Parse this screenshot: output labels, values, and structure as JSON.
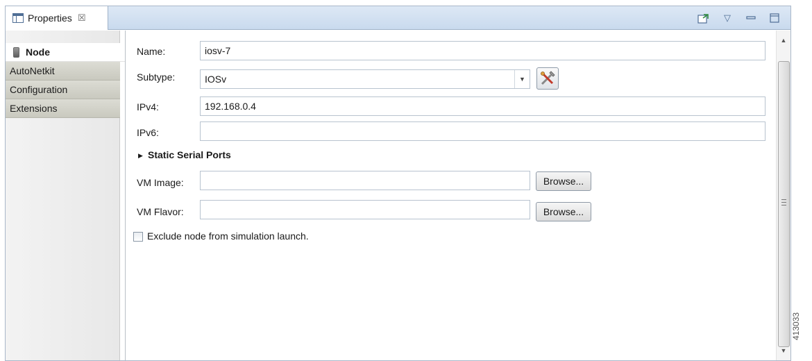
{
  "window": {
    "tab_title": "Properties",
    "tab_close_glyph": "☒",
    "actions": [
      {
        "name": "pin-editor-icon",
        "glyph": "↱"
      },
      {
        "name": "view-menu-icon",
        "glyph": "▽"
      },
      {
        "name": "minimize-icon",
        "glyph": "━"
      },
      {
        "name": "maximize-icon",
        "glyph": "□"
      }
    ]
  },
  "sidebar": {
    "items": [
      {
        "label": "Node",
        "selected": true,
        "icon": "node-icon"
      },
      {
        "label": "AutoNetkit",
        "selected": false
      },
      {
        "label": "Configuration",
        "selected": false
      },
      {
        "label": "Extensions",
        "selected": false
      }
    ]
  },
  "form": {
    "name": {
      "label": "Name:",
      "value": "iosv-7"
    },
    "subtype": {
      "label": "Subtype:",
      "value": "IOSv",
      "dropdown_glyph": "▼",
      "tool_icon": "configure-tools-icon"
    },
    "ipv4": {
      "label": "IPv4:",
      "value": "192.168.0.4"
    },
    "ipv6": {
      "label": "IPv6:",
      "value": ""
    },
    "serial_ports": {
      "label": "Static Serial Ports",
      "toggle_glyph": "▶",
      "expanded": false
    },
    "vm_image": {
      "label": "VM Image:",
      "value": "",
      "browse_label": "Browse..."
    },
    "vm_flavor": {
      "label": "VM Flavor:",
      "value": "",
      "browse_label": "Browse..."
    },
    "exclude": {
      "label": "Exclude node from simulation launch.",
      "checked": false
    }
  },
  "scrollbar": {
    "up_glyph": "▲",
    "down_glyph": "▼"
  },
  "figure_id": "413033",
  "colors": {
    "accent": "#4f6e95",
    "titlebar": "#c9daee",
    "nav_tab": "#c9c9bf"
  }
}
